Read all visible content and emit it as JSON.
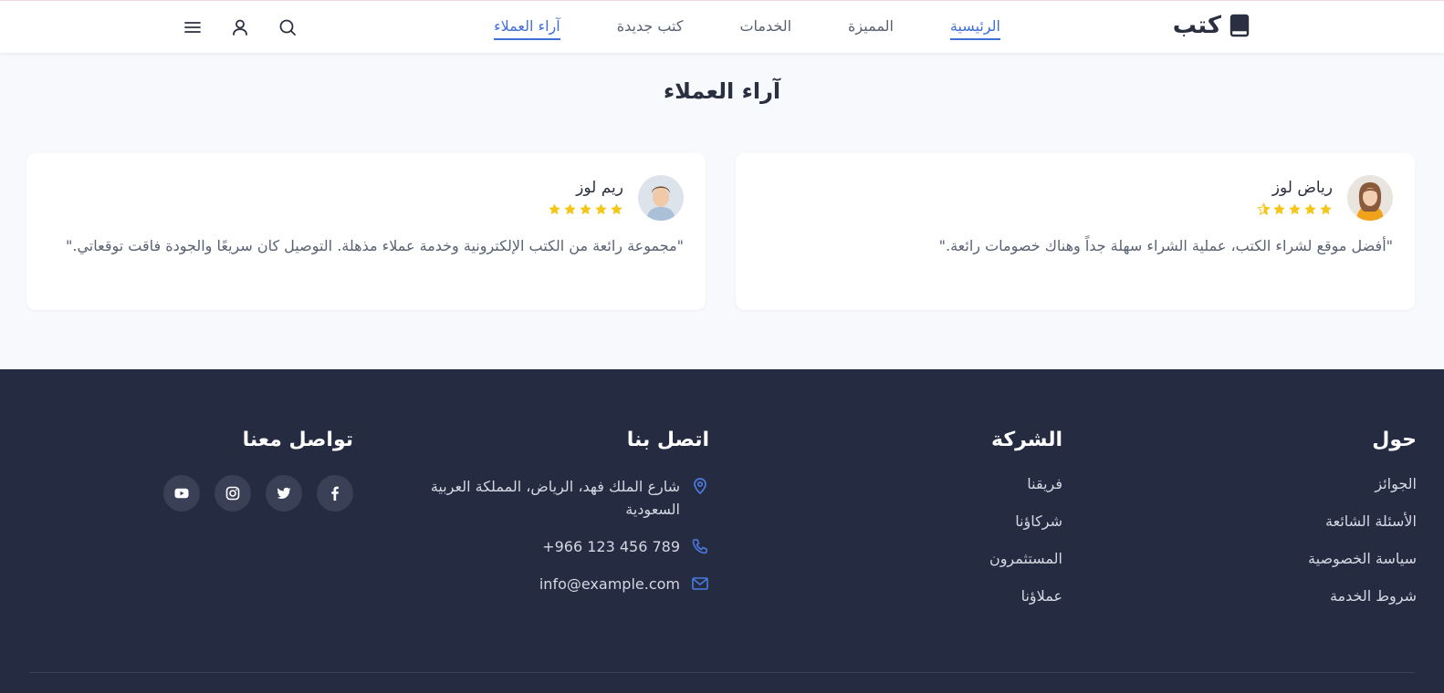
{
  "brand": {
    "name": "كتب"
  },
  "nav": {
    "items": [
      {
        "label": "الرئيسية",
        "active": true
      },
      {
        "label": "المميزة",
        "active": false
      },
      {
        "label": "الخدمات",
        "active": false
      },
      {
        "label": "كتب جديدة",
        "active": false
      },
      {
        "label": "آراء العملاء",
        "active": false
      }
    ]
  },
  "header_icons": [
    "search-icon",
    "user-icon",
    "menu-icon"
  ],
  "testimonials": {
    "title": "آراء العملاء",
    "items": [
      {
        "name": "رياض لوز",
        "rating": 4.5,
        "quote": "\"أفضل موقع لشراء الكتب، عملية الشراء سهلة جداً وهناك خصومات رائعة.\""
      },
      {
        "name": "ريم لوز",
        "rating": 5,
        "quote": "\"مجموعة رائعة من الكتب الإلكترونية وخدمة عملاء مذهلة. التوصيل كان سريعًا والجودة فاقت توقعاتي.\""
      }
    ]
  },
  "footer": {
    "about": {
      "title": "حول",
      "links": [
        "الجوائز",
        "الأسئلة الشائعة",
        "سياسة الخصوصية",
        "شروط الخدمة"
      ]
    },
    "company": {
      "title": "الشركة",
      "links": [
        "فريقنا",
        "شركاؤنا",
        "المستثمرون",
        "عملاؤنا"
      ]
    },
    "contact": {
      "title": "اتصل بنا",
      "address": "شارع الملك فهد، الرياض، المملكة العربية السعودية",
      "phone": "+966 123 456 789",
      "email": "info@example.com"
    },
    "social": {
      "title": "تواصل معنا",
      "icons": [
        "facebook-icon",
        "twitter-icon",
        "instagram-icon",
        "youtube-icon"
      ]
    }
  },
  "colors": {
    "accent": "#3f6fd8",
    "star": "#f5c518",
    "footer_bg": "#252c41"
  }
}
